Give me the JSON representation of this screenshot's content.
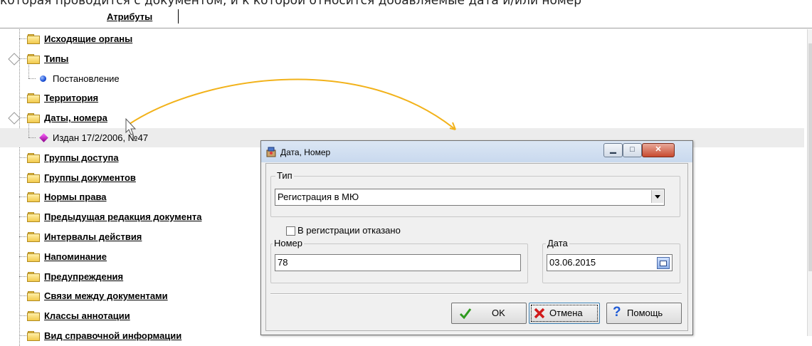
{
  "top_text": "которая проводится с документом, и к которой относится добавляемые дата и/или номер",
  "tabs": {
    "attributes": "Атрибуты"
  },
  "tree": {
    "items": [
      {
        "label": "Исходящие органы",
        "type": "folder"
      },
      {
        "label": "Типы",
        "type": "folder",
        "expanded": true
      },
      {
        "label": "Постановление",
        "type": "leaf",
        "icon": "blue-circle-icon"
      },
      {
        "label": "Территория",
        "type": "folder"
      },
      {
        "label": "Даты, номера",
        "type": "folder",
        "expanded": true
      },
      {
        "label": "Издан 17/2/2006, №47",
        "type": "leaf",
        "icon": "purple-diamond-icon",
        "selected": true
      },
      {
        "label": "Группы доступа",
        "type": "folder"
      },
      {
        "label": "Группы документов",
        "type": "folder"
      },
      {
        "label": "Нормы права",
        "type": "folder"
      },
      {
        "label": "Предыдущая редакция документа",
        "type": "folder"
      },
      {
        "label": "Интервалы действия",
        "type": "folder"
      },
      {
        "label": "Напоминание",
        "type": "folder"
      },
      {
        "label": "Предупреждения",
        "type": "folder"
      },
      {
        "label": "Связи между документами",
        "type": "folder"
      },
      {
        "label": "Классы аннотации",
        "type": "folder"
      },
      {
        "label": "Вид справочной информации",
        "type": "folder"
      }
    ]
  },
  "dialog": {
    "title": "Дата, Номер",
    "type_group": {
      "legend": "Тип",
      "value": "Регистрация в МЮ"
    },
    "refused_checkbox": {
      "label": "В регистрации отказано",
      "checked": false
    },
    "number_group": {
      "legend": "Номер",
      "value": "78"
    },
    "date_group": {
      "legend": "Дата",
      "value": "03.06.2015"
    },
    "buttons": {
      "ok": "OK",
      "cancel": "Отмена",
      "help": "Помощь"
    }
  },
  "colors": {
    "arrow": "#f2b21a",
    "selection": "#ececec",
    "folder": "#f2c94c"
  }
}
